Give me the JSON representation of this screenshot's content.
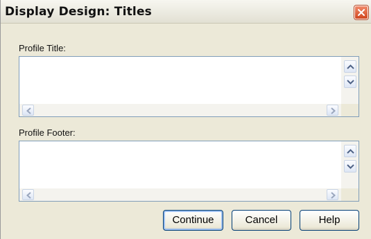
{
  "window": {
    "title": "Display Design: Titles"
  },
  "fields": {
    "profile_title": {
      "label": "Profile Title:",
      "value": ""
    },
    "profile_footer": {
      "label": "Profile Footer:",
      "value": ""
    }
  },
  "buttons": {
    "continue": "Continue",
    "cancel": "Cancel",
    "help": "Help"
  },
  "colors": {
    "dialog_bg": "#ece9d8",
    "field_border": "#7f9db9",
    "close_button": "#d0461f",
    "default_button_focus": "#9ec0f0"
  },
  "icons": [
    "close-icon",
    "chevron-up-icon",
    "chevron-down-icon",
    "chevron-left-icon",
    "chevron-right-icon"
  ]
}
